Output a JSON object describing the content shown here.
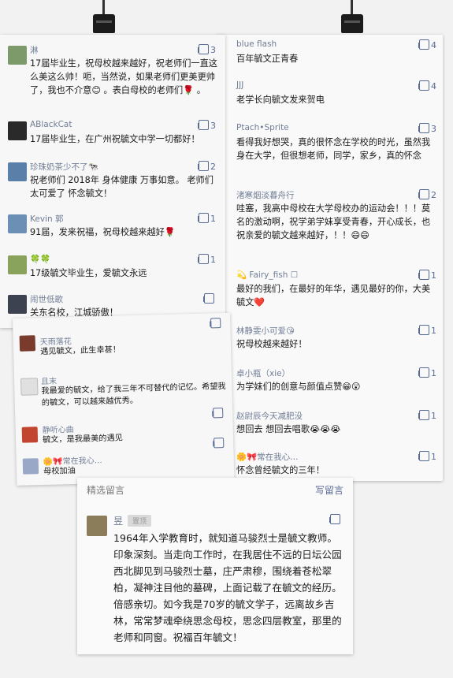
{
  "card1": {
    "comments": [
      {
        "name": "淋",
        "likes": "3",
        "text": "17届毕业生，祝母校越来越好，祝老师们一直这么美这么帅！呃，当然说，如果老师们更美更帅了，我也不介意😊 。表白母校的老师们🌹 。"
      },
      {
        "name": "ABlackCat",
        "likes": "3",
        "text": "17届毕业生，在广州祝毓文中学一切都好！"
      },
      {
        "name": "珍珠奶茶少不了🐄",
        "likes": "2",
        "text": "祝老师们 2018年 身体健康 万事如意。 老师们太可爱了 怀念毓文！"
      },
      {
        "name": "Kevin 郭",
        "likes": "1",
        "text": "91届，发来祝福，祝母校越来越好🌹"
      },
      {
        "name": "🍀🍀",
        "likes": "1",
        "text": "17级毓文毕业生，爱毓文永远"
      },
      {
        "name": "闹世低歌",
        "likes": "",
        "text": "关东名校，江城骄傲！"
      }
    ]
  },
  "card2": {
    "comments": [
      {
        "name": "blue flash",
        "likes": "4",
        "text": "百年毓文正青春"
      },
      {
        "name": "JJJ",
        "likes": "4",
        "text": "老学长向毓文发来贺电"
      },
      {
        "name": "Ptach•Sprite",
        "likes": "3",
        "text": "看得我好想哭，真的很怀念在学校的时光，虽然我身在大学，但很想老师，同学，家乡，真的怀念"
      },
      {
        "name": "渚寒烟淡暮舟行",
        "likes": "2",
        "text": "哇塞，我高中母校在大学母校办的运动会！！！莫名的激动啊，祝学弟学妹享受青春，开心成长，也祝亲爱的毓文越来越好，！！😄😄"
      },
      {
        "name": "💫 Fairy_fish ☐",
        "likes": "1",
        "text": "最好的我们，在最好的年华，遇见最好的你，大美毓文❤️"
      },
      {
        "name": "林静雯小可爱😘",
        "likes": "1",
        "text": "祝母校越来越好！"
      },
      {
        "name": "卓小瓶（xie）",
        "likes": "1",
        "text": "为学妹们的创意与颜值点赞😁😲"
      },
      {
        "name": "赵尉辰今天减肥没",
        "likes": "1",
        "text": "想回去 想回去唱歌😭😭😭"
      },
      {
        "name": "🌼🎀常在我心…",
        "likes": "1",
        "text": "怀念曾经毓文的三年！"
      }
    ]
  },
  "card3": {
    "comments": [
      {
        "name": "天雨落花",
        "text": "遇见毓文，此生幸甚！"
      },
      {
        "name": "且末",
        "text": "我最爱的毓文，给了我三年不可替代的记忆。希望我的毓文，可以越来越优秀。"
      },
      {
        "name": "静听心曲",
        "text": "毓文，是我最美的遇见"
      },
      {
        "name": "🌼🎀常在我心…",
        "text": "母校加油"
      }
    ]
  },
  "card4": {
    "header_label": "精选留言",
    "write_label": "写留言",
    "name": "昱",
    "pin_label": "置顶",
    "text": "1964年入学教育时，就知道马骏烈士是毓文教师。印象深刻。当走向工作时，在我居住不远的日坛公园西北脚见到马骏烈士墓，庄严肃穆，围绕着苍松翠柏，凝神注目他的墓碑，上面记载了在毓文的经历。倍感亲切。如今我是70岁的毓文学子，远离故乡吉林，常常梦魂牵绕思念母校，思念四层教室，那里的老师和同窗。祝福百年毓文！"
  },
  "colors": {
    "link": "#586b95",
    "name": "#6f7d95",
    "text": "#1a1a1a",
    "background": "#f2f2f2"
  }
}
